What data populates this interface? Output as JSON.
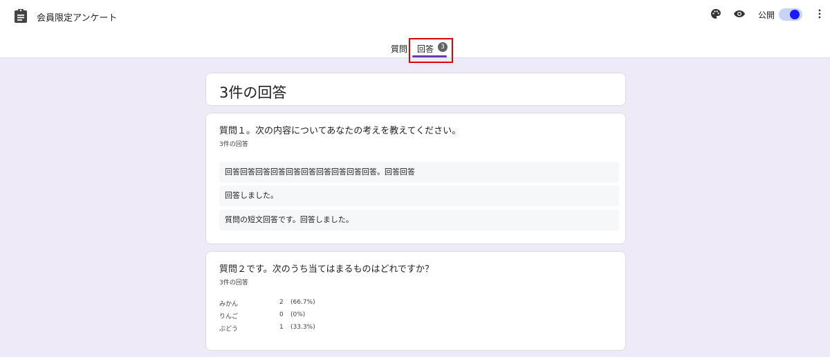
{
  "header": {
    "title": "会員限定アンケート",
    "publish_label": "公開",
    "publish_toggle_on": true,
    "accent_color": "#673ab7",
    "icons": [
      "clipboard-icon",
      "palette-icon",
      "eye-icon",
      "more-vert-icon"
    ]
  },
  "tabs": {
    "questions_label": "質問",
    "responses_label": "回答",
    "responses_badge": "3",
    "active": "responses"
  },
  "summary": {
    "title": "3件の回答"
  },
  "questions": [
    {
      "title": "質問１。次の内容についてあなたの考えを教えてください。",
      "count": "3件の回答",
      "answers": [
        "回答回答回答回答回答回答回答回答回答回答。回答回答",
        "回答しました。",
        "質問の短文回答です。回答しました。"
      ]
    },
    {
      "title": "質問２です。次のうち当てはまるものはどれですか？",
      "count": "3件の回答",
      "options": [
        {
          "name": "みかん",
          "count": "2",
          "percent": "(66.7%)"
        },
        {
          "name": "りんご",
          "count": "0",
          "percent": "(0%)"
        },
        {
          "name": "ぶどう",
          "count": "1",
          "percent": "(33.3%)"
        }
      ]
    }
  ]
}
